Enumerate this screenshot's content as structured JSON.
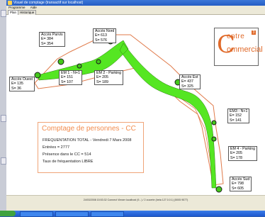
{
  "window": {
    "title": "Visuel de comptage (transactif sur localhost)",
    "menu": [
      "Programme",
      "Aide"
    ],
    "tabs": [
      "Plan",
      "Historique"
    ]
  },
  "logo": {
    "word1": "entre",
    "word2": "ommercial",
    "badge": "3"
  },
  "counters": {
    "parvis": {
      "name": "Accès Parvis",
      "e": "E= 384",
      "s": "S= 354"
    },
    "nord": {
      "name": "Accès Nord",
      "e": "E= 613",
      "s": "S= 576"
    },
    "ouest": {
      "name": "Accès Ouest",
      "e": "E= 135",
      "s": "S= 36"
    },
    "em1": {
      "name": "EM 1 - N+1",
      "e": "E= 151",
      "s": "S= 107"
    },
    "em2": {
      "name": "EM 2 - Parking",
      "e": "E= 205",
      "s": "S= 189"
    },
    "est": {
      "name": "Accès Est",
      "e": "E= 437",
      "s": "S= 325"
    },
    "em3": {
      "name": "EM3 - N+1",
      "e": "E= 152",
      "s": "S= 141"
    },
    "em4": {
      "name": "EM 4 - Parking",
      "e": "E= 205",
      "s": "S= 178"
    },
    "sud": {
      "name": "Accès Sud",
      "e": "E= 798",
      "s": "S= 605"
    }
  },
  "summary": {
    "title": "Comptage de personnes - CC",
    "line1": "FREQUENTATION TOTAL - Vendredi 7 Mars 2008",
    "line2": "Entrées = 2777",
    "line3": "Présence dans le CC = 514",
    "line4": "Taux de fréquentation LIBRE"
  },
  "status": {
    "text": "24/03/2008 15:53:32 Connect Viewer localhost (9...) / 2 ouverte (beta 127.0.0.1) (5005 9577)"
  },
  "colors": {
    "path_green": "#55e622",
    "outline_orange": "#e07a4a",
    "node_fill": "#44c81c"
  }
}
